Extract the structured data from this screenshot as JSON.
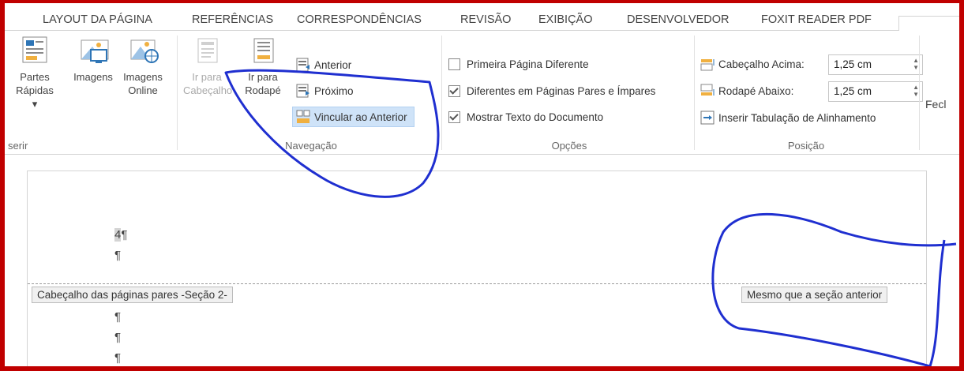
{
  "tabs": [
    "LAYOUT DA PÁGINA",
    "REFERÊNCIAS",
    "CORRESPONDÊNCIAS",
    "REVISÃO",
    "EXIBIÇÃO",
    "DESENVOLVEDOR",
    "FOXIT READER PDF"
  ],
  "ribbon": {
    "inserir": {
      "partes_line1": "Partes",
      "partes_line2": "Rápidas ▾",
      "imagens": "Imagens",
      "online_line1": "Imagens",
      "online_line2": "Online",
      "group": "serir"
    },
    "navegacao": {
      "ir_cab_line1": "Ir para",
      "ir_cab_line2": "Cabeçalho",
      "ir_rod_line1": "Ir para",
      "ir_rod_line2": "Rodapé",
      "anterior": "Anterior",
      "proximo": "Próximo",
      "vincular": "Vincular ao Anterior",
      "group": "Navegação"
    },
    "opcoes": {
      "primeira": "Primeira Página Diferente",
      "primeira_checked": false,
      "pares": "Diferentes em Páginas Pares e Ímpares",
      "pares_checked": true,
      "mostrar": "Mostrar Texto do Documento",
      "mostrar_checked": true,
      "group": "Opções"
    },
    "posicao": {
      "cab_label": "Cabeçalho Acima:",
      "cab_value": "1,25 cm",
      "rod_label": "Rodapé Abaixo:",
      "rod_value": "1,25 cm",
      "tabulacao": "Inserir Tabulação de Alinhamento",
      "group": "Posição"
    },
    "fechar": "Fecl"
  },
  "document": {
    "page_number": "4",
    "pilcrow": "¶",
    "header_tag": "Cabeçalho das páginas pares -Seção 2-",
    "same_as_prev": "Mesmo que a seção anterior"
  },
  "colors": {
    "frame": "#c00000",
    "annotation": "#1f2fd0",
    "selected": "#cfe3f8"
  }
}
